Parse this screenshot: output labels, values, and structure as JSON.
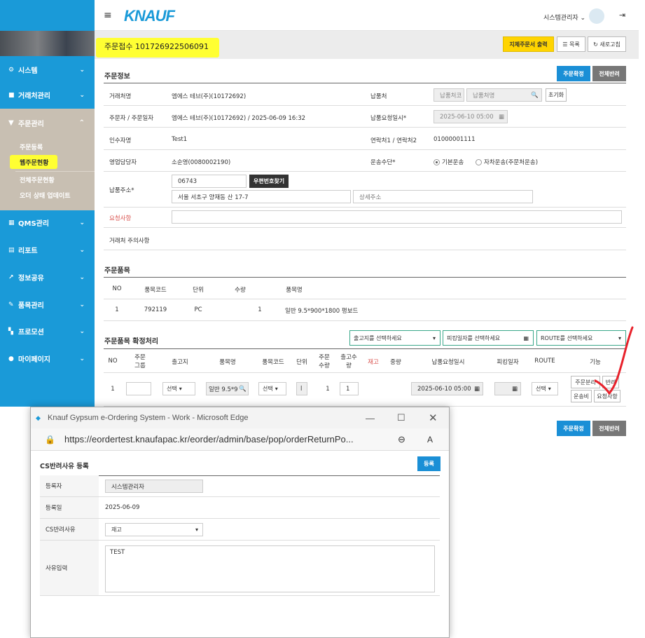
{
  "sidebar": {
    "items": [
      {
        "label": "시스템",
        "icon": "gear-icon"
      },
      {
        "label": "거래처관리",
        "icon": "bookmark-icon"
      },
      {
        "label": "주문관리",
        "icon": "cart-icon"
      },
      {
        "label": "QMS관리",
        "icon": "grid-icon"
      },
      {
        "label": "리포트",
        "icon": "doc-icon"
      },
      {
        "label": "정보공유",
        "icon": "share-icon"
      },
      {
        "label": "품목관리",
        "icon": "edit-icon"
      },
      {
        "label": "프로모션",
        "icon": "tiles-icon"
      },
      {
        "label": "마이페이지",
        "icon": "user-icon"
      }
    ],
    "sub_items": [
      "주문등록",
      "웹주문현황",
      "전체주문현황",
      "오더 상태 업데이트"
    ]
  },
  "header": {
    "logo": "KNAUF",
    "user": "시스템관리자 ⌄",
    "menu_icon": "≡",
    "logout_icon": "⇥"
  },
  "title": {
    "text": "주문접수 101726922506091",
    "print_btn": "지체주문서 출력",
    "list_btn": "목록",
    "refresh_btn": "새로고침"
  },
  "order_info": {
    "section": "주문정보",
    "confirm_btn": "주문확정",
    "reject_btn": "전체반려",
    "customer_label": "거래처명",
    "customer": "엠에스 테브(주)(10172692)",
    "delivery_place_label": "납품처",
    "delivery_place_code": "납품처코",
    "delivery_place_name": "납품처명",
    "init_btn": "초기화",
    "orderer_label": "주문자 / 주문일자",
    "orderer": "엠에스 테브(주)(10172692) / 2025-06-09 16:32",
    "req_date_label": "납품요청일시*",
    "req_date": "2025-06-10 05:00",
    "receiver_label": "인수자명",
    "receiver": "Test1",
    "contact_label": "연락처1 / 연락처2",
    "contact": "01000001111",
    "sales_label": "영업담당자",
    "sales": "소순영(0080002190)",
    "transport_label": "운송수단*",
    "transport_opt1": "기본운송",
    "transport_opt2": "자차운송(주문처운송)",
    "address_label": "납품주소*",
    "zipcode": "06743",
    "zip_btn": "우편번호찾기",
    "address": "서울 서초구 양재동 산 17-7",
    "address_detail": "상세주소",
    "request_label": "요청사항",
    "notice_label": "거래처 주의사항"
  },
  "items": {
    "section": "주문품목",
    "headers": [
      "NO",
      "품목코드",
      "단위",
      "수량",
      "품목명"
    ],
    "rows": [
      [
        "1",
        "792119",
        "PC",
        "1",
        "일반 9.5*900*1800 평보드"
      ]
    ]
  },
  "confirm": {
    "section": "주문품목 확정처리",
    "warehouse_select": "출고지를 선택하세요",
    "picking_select": "피킹일자를 선택하세요",
    "route_select": "ROUTE를 선택하세요",
    "headers": [
      "NO",
      "주문\n그룹",
      "출고지",
      "품목명",
      "품목코드",
      "단위",
      "주문\n수량",
      "출고수\n량",
      "재고",
      "중량",
      "납품요청일시",
      "피킹일자",
      "ROUTE",
      "기능"
    ],
    "row": {
      "no": "1",
      "sel": "선택",
      "item": "일반 9.5*9",
      "code_sel": "선택",
      "unit": "l",
      "qty": "1",
      "out_qty": "1",
      "req_date": "2025-06-10 05:00",
      "route_sel": "선택"
    },
    "btn_split": "주문분리",
    "btn_return": "반려",
    "btn_freight": "운송비",
    "btn_request": "요청사항"
  },
  "popup": {
    "title": "Knauf Gypsum e-Ordering System - Work - Microsoft Edge",
    "url": "https://eordertest.knaufapac.kr/eorder/admin/base/pop/orderReturnPo...",
    "heading": "CS반려사유 등록",
    "register_btn": "등록",
    "registrant_label": "등록자",
    "registrant": "시스템관리자",
    "date_label": "등록일",
    "date": "2025-06-09",
    "reason_label": "CS반려사유",
    "reason": "재고",
    "input_label": "사유입력",
    "input_text": "TEST"
  }
}
